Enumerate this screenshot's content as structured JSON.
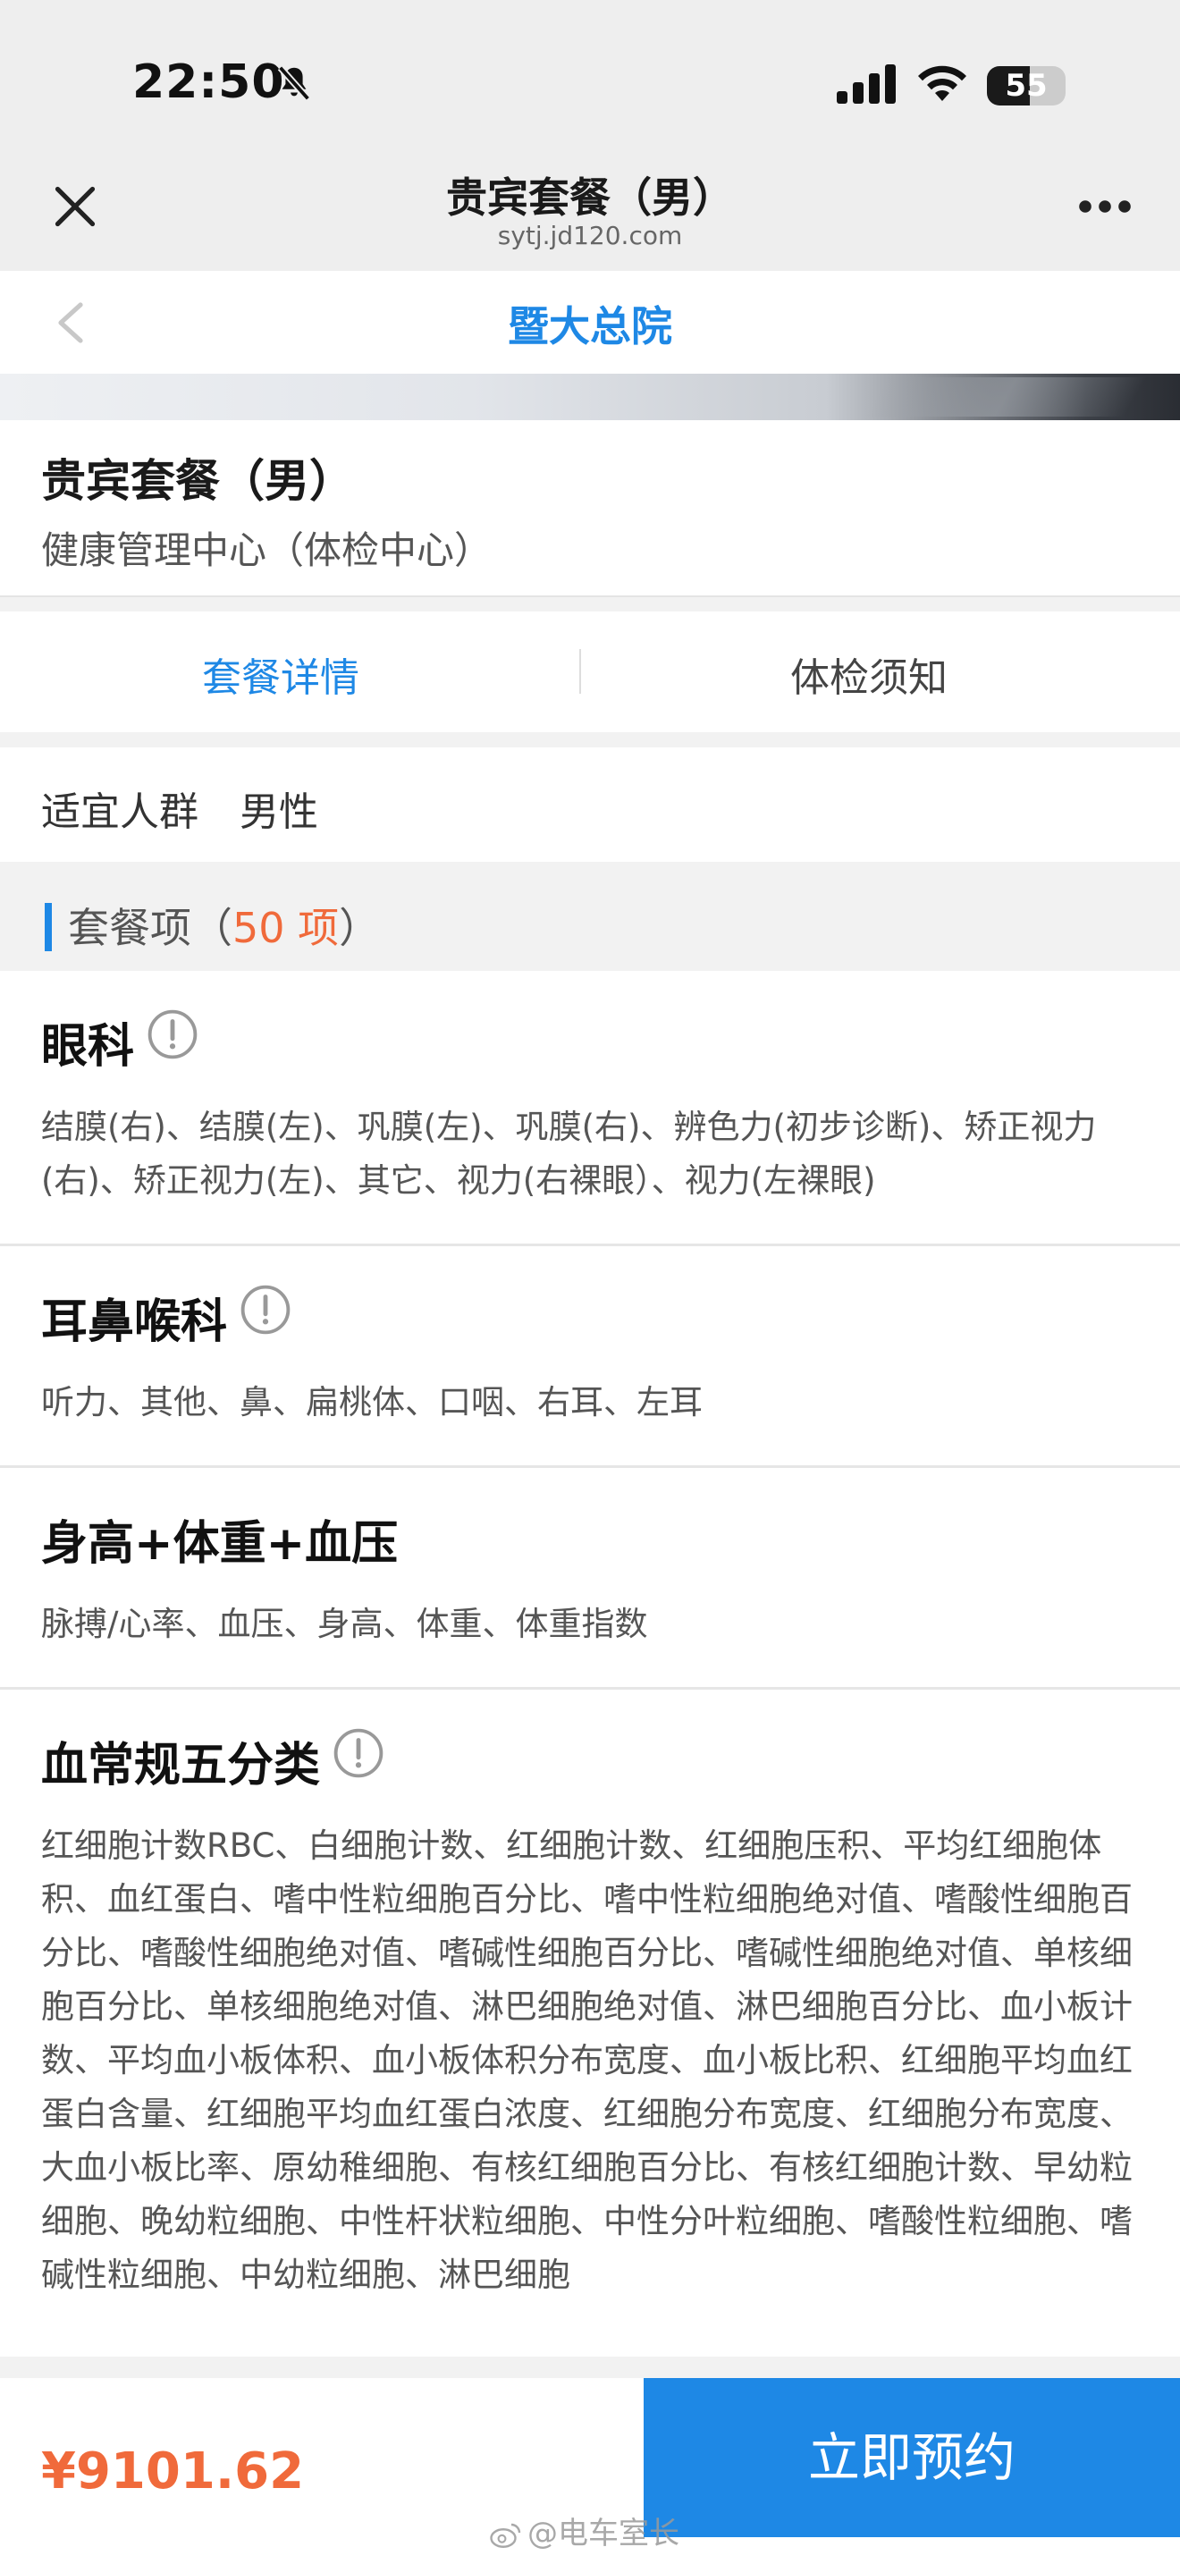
{
  "status_bar": {
    "time": "22:50",
    "battery": "55",
    "battery_level": 0.55
  },
  "browser": {
    "title": "贵宾套餐（男）",
    "domain": "sytj.jd120.com"
  },
  "hospital": {
    "title": "暨大总院"
  },
  "package": {
    "name": "贵宾套餐（男）",
    "center": "健康管理中心（体检中心）"
  },
  "tabs": [
    {
      "label": "套餐详情",
      "active": true
    },
    {
      "label": "体检须知",
      "active": false
    }
  ],
  "suitable": {
    "label": "适宜人群",
    "value": "男性"
  },
  "section": {
    "prefix": "套餐项（",
    "count": "50 项",
    "suffix": "）"
  },
  "categories": [
    {
      "title": "眼科",
      "items": "结膜(右)、结膜(左)、巩膜(左)、巩膜(右)、辨色力(初步诊断)、矫正视力(右)、矫正视力(左)、其它、视力(右裸眼）、视力(左裸眼)"
    },
    {
      "title": "耳鼻喉科",
      "items": "听力、其他、鼻、扁桃体、口咽、右耳、左耳"
    },
    {
      "title": "身高+体重+血压",
      "items": "脉搏/心率、血压、身高、体重、体重指数"
    },
    {
      "title": "血常规五分类",
      "items": "红细胞计数RBC、白细胞计数、红细胞计数、红细胞压积、平均红细胞体积、血红蛋白、嗜中性粒细胞百分比、嗜中性粒细胞绝对值、嗜酸性细胞百分比、嗜酸性细胞绝对值、嗜碱性细胞百分比、嗜碱性细胞绝对值、单核细胞百分比、单核细胞绝对值、淋巴细胞绝对值、淋巴细胞百分比、血小板计数、平均血小板体积、血小板体积分布宽度、血小板比积、红细胞平均血红蛋白含量、红细胞平均血红蛋白浓度、红细胞分布宽度、红细胞分布宽度、大血小板比率、原幼稚细胞、有核红细胞百分比、有核红细胞计数、早幼粒细胞、晚幼粒细胞、中性杆状粒细胞、中性分叶粒细胞、嗜酸性粒细胞、嗜碱性粒细胞、中幼粒细胞、淋巴细胞"
    }
  ],
  "footer": {
    "price": "¥9101.62",
    "book_label": "立即预约"
  },
  "watermark": "@电车室长",
  "colors": {
    "accent": "#1e88e5",
    "price": "#f06a3b"
  },
  "icons": {
    "close": "close-icon",
    "more": "more-icon",
    "back": "back-chevron-icon",
    "info": "info-circle-icon"
  }
}
